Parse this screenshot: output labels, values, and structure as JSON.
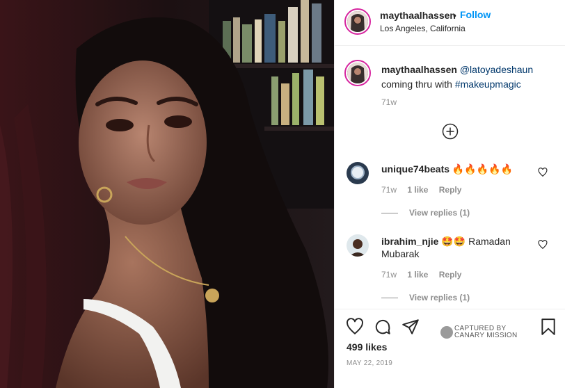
{
  "header": {
    "username": "maythaalhassen",
    "separator": "•",
    "follow_label": "Follow",
    "location": "Los Angeles, California"
  },
  "caption": {
    "username": "maythaalhassen",
    "mention": "@latoyadeshaun",
    "text": "coming thru with",
    "hashtag": "#makeupmagic",
    "time": "71w"
  },
  "comments": [
    {
      "username": "unique74beats",
      "text": "🔥🔥🔥🔥🔥",
      "time": "71w",
      "likes": "1 like",
      "reply_label": "Reply",
      "view_replies": "View replies (1)"
    },
    {
      "username": "ibrahim_njie",
      "text": "🤩🤩 Ramadan Mubarak",
      "time": "71w",
      "likes": "1 like",
      "reply_label": "Reply",
      "view_replies": "View replies (1)"
    }
  ],
  "watermark": {
    "line1": "CAPTURED BY",
    "line2": "CANARY MISSION"
  },
  "post": {
    "likes": "499 likes",
    "date": "MAY 22, 2019"
  },
  "icons": {
    "like": "heart-icon",
    "comment": "comment-icon",
    "share": "share-icon",
    "save": "bookmark-icon",
    "load_more": "plus-circle-icon",
    "comment_like": "small-heart-icon"
  },
  "colors": {
    "link": "#0095f6",
    "hashtag": "#00376b",
    "muted": "#8e8e8e",
    "text": "#262626",
    "story_ring": "#d6249f"
  }
}
